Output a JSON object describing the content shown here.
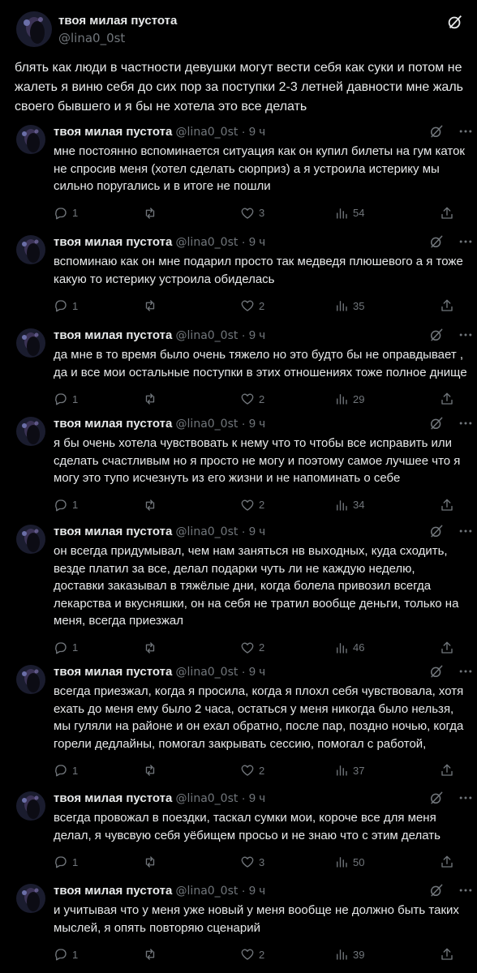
{
  "main": {
    "name": "твоя милая пустота",
    "handle": "@lina0_0st",
    "text": "блять как люди в частности девушки могут вести себя как суки и потом не жалеть я виню себя до сих пор за поступки 2-3 летней давности мне жаль своего бывшего и я бы не хотела это все делать"
  },
  "replies": [
    {
      "name": "твоя милая пустота",
      "handle": "@lina0_0st",
      "sep": "·",
      "time": "9 ч",
      "text": "мне постоянно вспоминается ситуация как он купил билеты на гум каток не спросив меня (хотел сделать сюрприз) а я устроила истерику мы сильно поругались и в итоге не пошли",
      "replies": "1",
      "likes": "3",
      "views": "54"
    },
    {
      "name": "твоя милая пустота",
      "handle": "@lina0_0st",
      "sep": "·",
      "time": "9 ч",
      "text": "вспоминаю как он мне подарил просто так медведя плюшевого а я тоже какую то истерику устроила обиделась",
      "replies": "1",
      "likes": "2",
      "views": "35"
    },
    {
      "name": "твоя милая пустота",
      "handle": "@lina0_0st",
      "sep": "·",
      "time": "9 ч",
      "text": "да мне в то время было очень тяжело но это будто бы не оправдывает , да и все мои остальные поступки в этих отношениях тоже полное днище",
      "replies": "1",
      "likes": "2",
      "views": "29"
    },
    {
      "name": "твоя милая пустота",
      "handle": "@lina0_0st",
      "sep": "·",
      "time": "9 ч",
      "text": "я бы очень хотела чувствовать к нему что то чтобы все исправить или сделать счастливым но я просто не могу и поэтому самое лучшее что я могу это тупо исчезнуть из его жизни и не напоминать о себе",
      "replies": "1",
      "likes": "2",
      "views": "34"
    },
    {
      "name": "твоя милая пустота",
      "handle": "@lina0_0st",
      "sep": "·",
      "time": "9 ч",
      "text": "он всегда придумывал, чем нам заняться нв выходных, куда сходить, везде платил за все, делал подарки чуть ли не каждую неделю, доставки заказывал в тяжёлые дни, когда болела привозил всегда лекарства и вкусняшки, он на себя не тратил вообще деньги, только на меня, всегда приезжал",
      "replies": "1",
      "likes": "2",
      "views": "46"
    },
    {
      "name": "твоя милая пустота",
      "handle": "@lina0_0st",
      "sep": "·",
      "time": "9 ч",
      "text": "всегда приезжал, когда я просила, когда я плохл себя чувствовала, хотя ехать до меня ему было 2 часа, остаться у меня никогда было нельзя, мы гуляли на районе и он ехал обратно, после пар, поздно ночью, когда горели дедлайны, помогал закрывать сессию, помогал с работой,",
      "replies": "1",
      "likes": "2",
      "views": "37"
    },
    {
      "name": "твоя милая пустота",
      "handle": "@lina0_0st",
      "sep": "·",
      "time": "9 ч",
      "text": "всегда провожал в поездки, таскал сумки мои, короче все для меня делал, я чувсвую себя уёбищем просьо и не знаю что с этим делать",
      "replies": "1",
      "likes": "3",
      "views": "50"
    },
    {
      "name": "твоя милая пустота",
      "handle": "@lina0_0st",
      "sep": "·",
      "time": "9 ч",
      "text": "и учитывая что у меня уже новый у меня вообще не должно быть таких мыслей, я опять повторяю сценарий",
      "replies": "1",
      "likes": "2",
      "views": "39"
    }
  ],
  "icons": {
    "grok": "grok-icon",
    "more": "more-icon",
    "reply": "reply-icon",
    "retweet": "retweet-icon",
    "like": "heart-icon",
    "views": "views-icon",
    "share": "share-icon"
  },
  "colors": {
    "background": "#000000",
    "text": "#e7e9ea",
    "muted": "#71767b"
  }
}
